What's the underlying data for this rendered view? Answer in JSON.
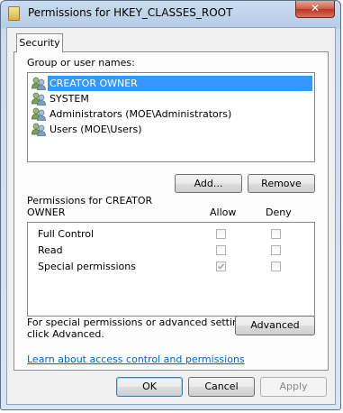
{
  "window": {
    "title": "Permissions for HKEY_CLASSES_ROOT",
    "close_glyph": "✕"
  },
  "tabs": [
    {
      "label": "Security"
    }
  ],
  "group_label": "Group or user names:",
  "users": [
    {
      "name": "CREATOR OWNER",
      "selected": true
    },
    {
      "name": "SYSTEM",
      "selected": false
    },
    {
      "name": "Administrators (MOE\\Administrators)",
      "selected": false
    },
    {
      "name": "Users (MOE\\Users)",
      "selected": false
    }
  ],
  "buttons": {
    "add": "Add...",
    "remove": "Remove",
    "advanced": "Advanced",
    "ok": "OK",
    "cancel": "Cancel",
    "apply": "Apply"
  },
  "permissions": {
    "heading_line1": "Permissions for CREATOR",
    "heading_line2": "OWNER",
    "allow_header": "Allow",
    "deny_header": "Deny",
    "rows": [
      {
        "name": "Full Control",
        "allow": false,
        "deny": false
      },
      {
        "name": "Read",
        "allow": false,
        "deny": false
      },
      {
        "name": "Special permissions",
        "allow": true,
        "deny": false
      }
    ]
  },
  "advanced_text_line1": "For special permissions or advanced settings,",
  "advanced_text_line2": "click Advanced.",
  "help_link": "Learn about access control and permissions",
  "icons": {
    "title": "folder-icon",
    "user": "user-group-icon",
    "close": "close-icon",
    "check": "checkmark-icon"
  }
}
